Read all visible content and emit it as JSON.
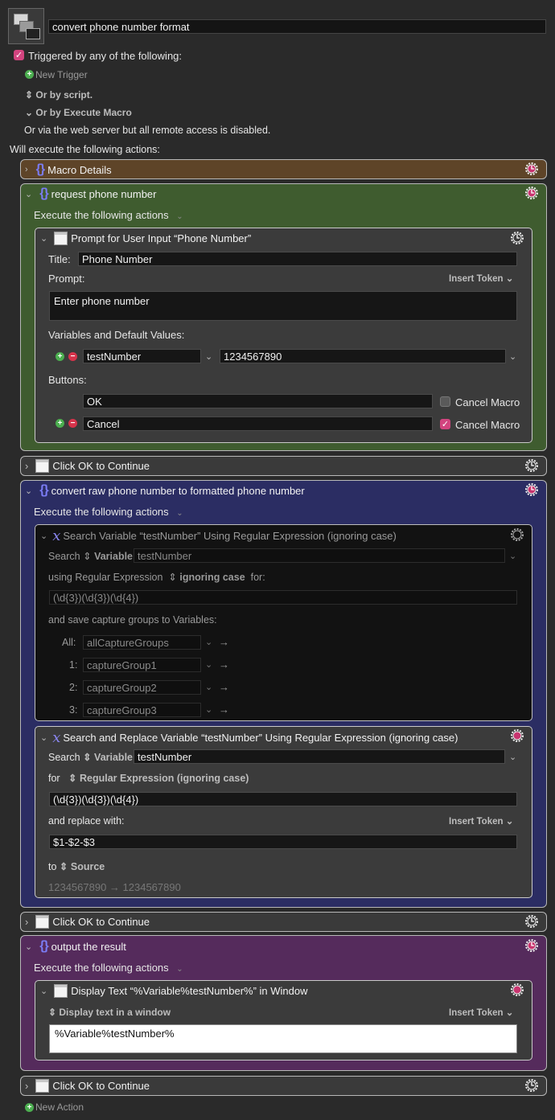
{
  "macro": {
    "title": "convert phone number format"
  },
  "trigger": {
    "label": "Triggered by any of the following:",
    "checked": true,
    "new_trigger": "New Trigger",
    "or_script": "Or by script.",
    "or_execute": "Or by Execute Macro",
    "web_server": "Or via the web server but all remote access is disabled.",
    "will_execute": "Will execute the following actions:"
  },
  "colors": {
    "macro_details": "#5e4428",
    "request_group": "#3f5c2f",
    "convert_group": "#2b2d63",
    "output_group": "#552b5c",
    "accent_pink": "#d2447f"
  },
  "groups": {
    "macro_details": {
      "title": "Macro Details"
    },
    "request": {
      "title": "request phone number",
      "execute": "Execute the following actions",
      "prompt": {
        "header": "Prompt for User Input “Phone Number”",
        "title_label": "Title:",
        "title_value": "Phone Number",
        "prompt_label": "Prompt:",
        "insert_token": "Insert Token",
        "prompt_value": "Enter phone number",
        "vars_label": "Variables and Default Values:",
        "var_name": "testNumber",
        "var_default": "1234567890",
        "buttons_label": "Buttons:",
        "btn1": "OK",
        "btn1_cancel": "Cancel Macro",
        "btn1_checked": false,
        "btn2": "Cancel",
        "btn2_cancel": "Cancel Macro",
        "btn2_checked": true
      }
    },
    "click1": {
      "title": "Click OK to Continue"
    },
    "convert": {
      "title": "convert raw phone number to formatted phone number",
      "execute": "Execute the following actions",
      "search": {
        "header": "Search Variable “testNumber” Using Regular Expression (ignoring case)",
        "search_label": "Search",
        "variable_label": "Variable",
        "variable_value": "testNumber",
        "using_label": "using Regular Expression",
        "ignoring": "ignoring case",
        "for_label": "for:",
        "regex": "(\\d{3})(\\d{3})(\\d{4})",
        "save_label": "and save capture groups to Variables:",
        "captures": [
          {
            "label": "All:",
            "value": "allCaptureGroups"
          },
          {
            "label": "1:",
            "value": "captureGroup1"
          },
          {
            "label": "2:",
            "value": "captureGroup2"
          },
          {
            "label": "3:",
            "value": "captureGroup3"
          }
        ]
      },
      "replace": {
        "header": "Search and Replace Variable “testNumber” Using Regular Expression (ignoring case)",
        "search_label": "Search",
        "variable_label": "Variable",
        "variable_value": "testNumber",
        "for_label": "for",
        "mode": "Regular Expression (ignoring case)",
        "regex": "(\\d{3})(\\d{3})(\\d{4})",
        "replace_label": "and replace with:",
        "insert_token": "Insert Token",
        "replace_value": "$1-$2-$3",
        "to_label": "to",
        "to_value": "Source",
        "preview": "1234567890 → 1234567890"
      }
    },
    "click2": {
      "title": "Click OK to Continue"
    },
    "output": {
      "title": "output the result",
      "execute": "Execute the following actions",
      "display": {
        "header": "Display Text “%Variable%testNumber%” in Window",
        "mode": "Display text in a window",
        "insert_token": "Insert Token",
        "text": "%Variable%testNumber%"
      }
    },
    "click3": {
      "title": "Click OK to Continue"
    }
  },
  "new_action": "New Action",
  "icons": {
    "gear": "gear-icon",
    "braces": "group-braces-icon",
    "window": "window-icon",
    "regex": "regex-x-icon"
  }
}
